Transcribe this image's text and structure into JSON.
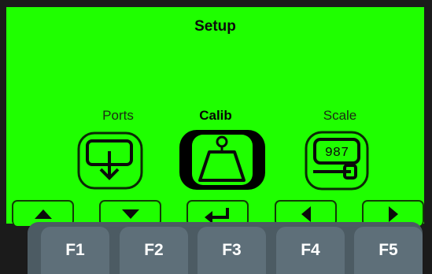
{
  "screen": {
    "title": "Setup"
  },
  "modes": [
    {
      "label": "Ports",
      "icon": "ports-icon",
      "selected": false
    },
    {
      "label": "Calib",
      "icon": "calibration-weight-icon",
      "selected": true
    },
    {
      "label": "Scale",
      "icon": "scale-display-icon",
      "selected": false
    }
  ],
  "scale_icon_readout": "987",
  "softkeys": [
    {
      "icon": "up-arrow-icon"
    },
    {
      "icon": "down-arrow-icon"
    },
    {
      "icon": "enter-icon"
    },
    {
      "icon": "left-arrow-icon"
    },
    {
      "icon": "right-arrow-icon"
    }
  ],
  "function_keys": [
    "F1",
    "F2",
    "F3",
    "F4",
    "F5"
  ],
  "colors": {
    "lcd_background": "#1fff00",
    "key_face": "#5e6f79",
    "bezel": "#1b1b1b"
  }
}
